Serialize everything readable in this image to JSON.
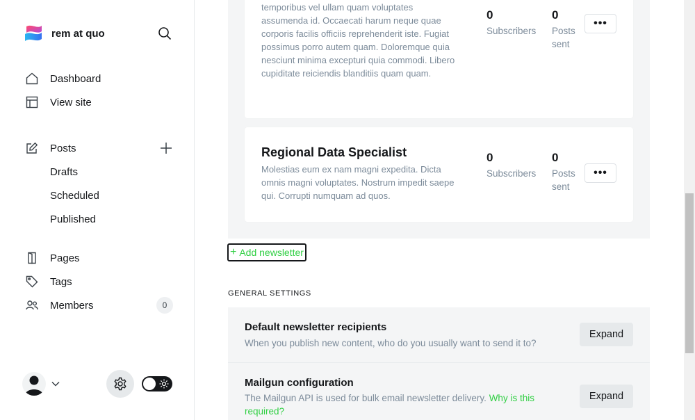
{
  "brand": {
    "site_title": "rem at quo",
    "logo_icon": "ghost-logo-icon"
  },
  "sidebar": {
    "nav": [
      {
        "label": "Dashboard",
        "icon": "home-icon"
      },
      {
        "label": "View site",
        "icon": "layout-icon"
      }
    ],
    "posts": {
      "label": "Posts",
      "icon": "edit-icon",
      "add_icon": "plus-icon",
      "sub_items": [
        "Drafts",
        "Scheduled",
        "Published"
      ]
    },
    "nav_bottom": [
      {
        "label": "Pages",
        "icon": "page-icon"
      },
      {
        "label": "Tags",
        "icon": "tag-icon"
      },
      {
        "label": "Members",
        "icon": "members-icon",
        "count": "0"
      }
    ],
    "footer": {
      "avatar_icon": "user-avatar-icon",
      "chevron_icon": "chevron-down-icon",
      "settings_icon": "gear-icon",
      "theme_toggle_icon": "sun-icon"
    }
  },
  "newsletters": [
    {
      "name": "",
      "description": "Quod at asperiores enim impedit quaerat. Quia temporibus vel ullam quam voluptates assumenda id. Occaecati harum neque quae corporis facilis officiis reprehenderit iste. Fugiat possimus porro autem quam. Doloremque quia nesciunt minima excepturi quia commodi. Libero cupiditate reiciendis blanditiis quam quam.",
      "subscribers": "0",
      "subscribers_label": "Subscribers",
      "posts_sent": "0",
      "posts_sent_label": "Posts sent",
      "more_label": "•••"
    },
    {
      "name": "Regional Data Specialist",
      "description": "Molestias eum ex nam magni expedita. Dicta omnis magni voluptates. Nostrum impedit saepe qui. Corrupti numquam ad quos.",
      "subscribers": "0",
      "subscribers_label": "Subscribers",
      "posts_sent": "0",
      "posts_sent_label": "Posts sent",
      "more_label": "•••"
    }
  ],
  "add_newsletter": {
    "plus": "+",
    "label": "Add newsletter"
  },
  "general_settings": {
    "section_title": "GENERAL SETTINGS",
    "items": [
      {
        "title": "Default newsletter recipients",
        "description": "When you publish new content, who do you usually want to send it to?",
        "button": "Expand"
      },
      {
        "title": "Mailgun configuration",
        "description": "The Mailgun API is used for bulk email newsletter delivery.",
        "link": "Why is this required?",
        "button": "Expand"
      }
    ]
  },
  "colors": {
    "accent_green": "#30cf43",
    "text": "#15171a",
    "muted": "#7c8b9a",
    "panel": "#f4f5f6"
  }
}
